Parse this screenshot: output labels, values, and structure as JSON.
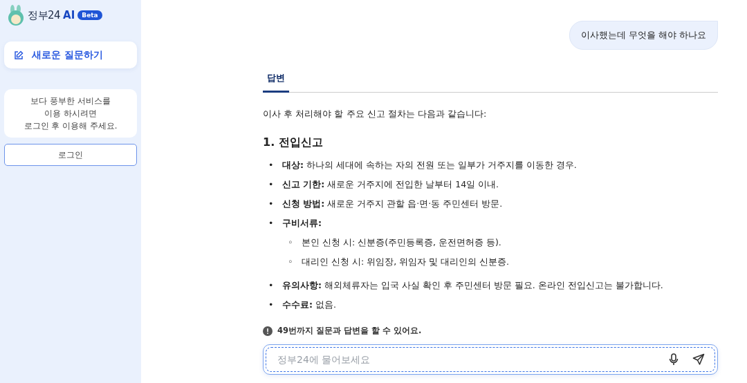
{
  "sidebar": {
    "logo": {
      "name": "정부24",
      "ai": "AI",
      "badge": "Beta"
    },
    "new_question_button": "새로운 질문하기",
    "login_notice": [
      "보다 풍부한 서비스를",
      "이용 하시려면",
      "로그인 후 이용해 주세요."
    ],
    "login_button": "로그인"
  },
  "chat": {
    "user_message": "이사했는데 무엇을 해야 하나요",
    "tabs": [
      {
        "label": "답변",
        "selected": true
      }
    ],
    "answer": {
      "intro": "이사 후 처리해야 할 주요 신고 절차는 다음과 같습니다:",
      "heading": "1. 전입신고",
      "items": [
        {
          "marker": "•",
          "text": "**대상:** 하나의 세대에 속하는 자의 전원 또는 일부가 거주지를 이동한 경우."
        },
        {
          "marker": "•",
          "text": "**신고 기한:** 새로운 거주지에 전입한 날부터 14일 이내."
        },
        {
          "marker": "•",
          "text": "**신청 방법:** 새로운 거주지 관할 읍·면·동 주민센터 방문."
        },
        {
          "marker": "•",
          "text": "**구비서류:**",
          "children": [
            {
              "marker": "◦",
              "text": "본인 신청 시: 신분증(주민등록증, 운전면허증 등)."
            },
            {
              "marker": "◦",
              "text": "대리인 신청 시: 위임장, 위임자 및 대리인의 신분증."
            }
          ]
        },
        {
          "marker": "•",
          "text": "**유의사항:** 해외체류자는 입국 사실 확인 후 주민센터 방문 필요. 온라인 전입신고는 불가합니다."
        },
        {
          "marker": "•",
          "text": "**수수료:** 없음."
        }
      ]
    },
    "notice": "49번까지 질문과 답변을 할 수 있어요.",
    "input": {
      "placeholder": "정부24에 물어보세요"
    }
  }
}
